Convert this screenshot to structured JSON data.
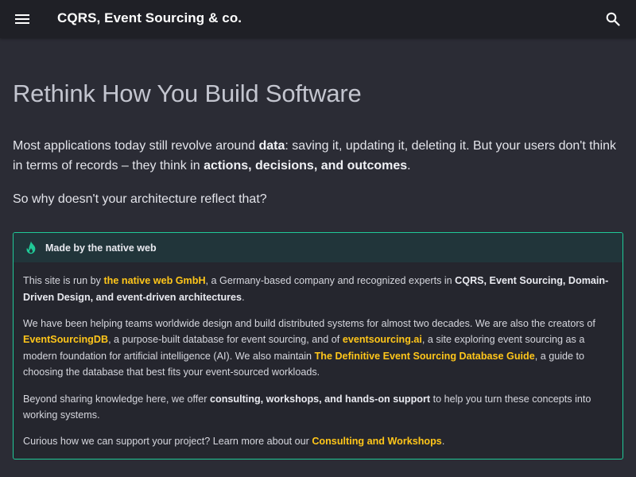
{
  "header": {
    "title": "CQRS, Event Sourcing & co.",
    "menu_icon": "menu-icon",
    "search_icon": "search-icon"
  },
  "main": {
    "heading": "Rethink How You Build Software",
    "intro": {
      "t1": "Most applications today still revolve around ",
      "b1": "data",
      "t2": ": saving it, updating it, deleting it. But your users don't think in terms of records – they think in ",
      "b2": "actions, decisions, and outcomes",
      "t3": "."
    },
    "question": "So why doesn't your architecture reflect that?"
  },
  "callout": {
    "icon": "flame-icon",
    "title": "Made by the native web",
    "p1": {
      "t1": "This site is run by ",
      "l1": "the native web GmbH",
      "t2": ", a Germany-based company and recognized experts in ",
      "b1": "CQRS, Event Sourcing, Domain-Driven Design, and event-driven architectures",
      "t3": "."
    },
    "p2": {
      "t1": "We have been helping teams worldwide design and build distributed systems for almost two decades. We are also the creators of ",
      "l1": "EventSourcingDB",
      "t2": ", a purpose-built database for event sourcing, and of ",
      "l2": "eventsourcing.ai",
      "t3": ", a site exploring event sourcing as a modern foundation for artificial intelligence (AI). We also maintain ",
      "l3": "The Definitive Event Sourcing Database Guide",
      "t4": ", a guide to choosing the database that best fits your event-sourced workloads."
    },
    "p3": {
      "t1": "Beyond sharing knowledge here, we offer ",
      "b1": "consulting, workshops, and hands-on support",
      "t2": " to help you turn these concepts into working systems."
    },
    "p4": {
      "t1": "Curious how we can support your project? Learn more about our ",
      "l1": "Consulting and Workshops",
      "t2": "."
    }
  },
  "colors": {
    "header_bg": "#1f2026",
    "page_bg": "#2b2c35",
    "accent_link": "#ffc61a",
    "callout_border": "#20c997"
  }
}
